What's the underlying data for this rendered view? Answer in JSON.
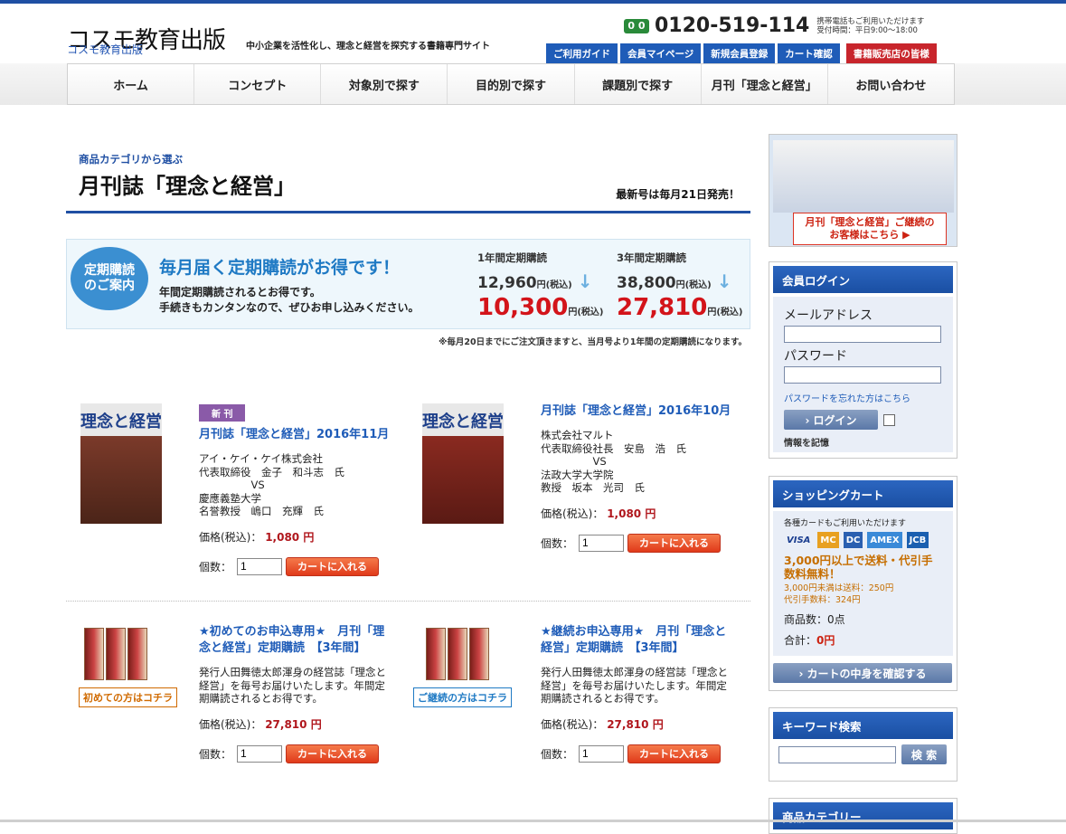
{
  "header": {
    "logo": "コスモ教育出版",
    "logo_alt": "コスモ教育出版",
    "tagline": "中小企業を活性化し、理念と経営を探究する書籍専門サイト",
    "phone_icon": "0 0",
    "phone": "0120-519-114",
    "phone_note_1": "携帯電話もご利用いただけます",
    "phone_note_2": "受付時間：平日9:00～18:00",
    "util_links": [
      "ご利用ガイド",
      "会員マイページ",
      "新規会員登録",
      "カート確認",
      "書籍販売店の皆様"
    ]
  },
  "nav": [
    "ホーム",
    "コンセプト",
    "対象別で探す",
    "目的別で探す",
    "課題別で探す",
    "月刊「理念と経営」",
    "お問い合わせ"
  ],
  "category": {
    "sub": "商品カテゴリから選ぶ",
    "title": "月刊誌「理念と経営」",
    "note": "最新号は毎月21日発売！"
  },
  "promo": {
    "badge_1": "定期購読",
    "badge_2": "のご案内",
    "headline": "毎月届く定期購読がお得です！",
    "desc_1": "年間定期購読されるとお得です。",
    "desc_2": "手続きもカンタンなので、ぜひお申し込みください。",
    "plan1_label": "1年間定期購読",
    "plan1_old": "12,960",
    "plan1_new": "10,300",
    "plan2_label": "3年間定期購読",
    "plan2_old": "38,800",
    "plan2_new": "27,810",
    "yen_tax": "円(税込)",
    "footnote": "※毎月20日までにご注文頂きますと、当月号より1年間の定期購読になります。"
  },
  "thumbs": {
    "magazine_title": "理念と経営",
    "label_first": "初めての方はコチラ",
    "label_continue": "ご継続の方はコチラ"
  },
  "products": [
    {
      "badge": "新 刊",
      "title": "月刊誌「理念と経営」2016年11月",
      "desc": "アイ・ケイ・ケイ株式会社\n代表取締役　金子　和斗志　氏\n　　　　　VS\n慶應義塾大学\n名誉教授　嶋口　充輝　氏",
      "price_label": "価格(税込)：",
      "price": "1,080 円",
      "qty_label": "個数：",
      "qty": "1",
      "cart": "カートに入れる"
    },
    {
      "title": "月刊誌「理念と経営」2016年10月",
      "desc": "株式会社マルト\n代表取締役社長　安島　浩　氏\n　　　　　VS\n法政大学大学院\n教授　坂本　光司　氏",
      "price_label": "価格(税込)：",
      "price": "1,080 円",
      "qty_label": "個数：",
      "qty": "1",
      "cart": "カートに入れる"
    },
    {
      "title": "★初めてのお申込専用★　月刊「理念と経営」定期購読　【3年間】",
      "desc": "発行人田舞徳太郎渾身の経営誌「理念と経営」を毎号お届けいたします。年間定期購読されるとお得です。",
      "price_label": "価格(税込)：",
      "price": "27,810 円",
      "qty_label": "個数：",
      "qty": "1",
      "cart": "カートに入れる"
    },
    {
      "title": "★継続お申込専用★　月刊「理念と経営」定期購読　【3年間】",
      "desc": "発行人田舞徳太郎渾身の経営誌「理念と経営」を毎号お届けいたします。年間定期購読されるとお得です。",
      "price_label": "価格(税込)：",
      "price": "27,810 円",
      "qty_label": "個数：",
      "qty": "1",
      "cart": "カートに入れる"
    }
  ],
  "sidebar": {
    "banner_1": "月刊「理念と経営」ご継続の",
    "banner_2": "お客様はこちら ▶",
    "login": {
      "title": "会員ログイン",
      "email_label": "メールアドレス",
      "password_label": "パスワード",
      "forgot": "パスワードを忘れた方はこちら",
      "button": "› ログイン",
      "remember": "情報を記憶"
    },
    "cart": {
      "title": "ショッピングカート",
      "cards_note": "各種カードもご利用いただけます",
      "cards": [
        "VISA",
        "MC",
        "DC",
        "AMEX",
        "JCB"
      ],
      "ship_free": "3,000円以上で送料・代引手数料無料！",
      "ship_note_1": "3,000円未満は送料：250円",
      "ship_note_2": "代引手数料：324円",
      "count_label": "商品数：",
      "count": "0点",
      "total_label": "合計：",
      "total": "0円",
      "button": "› カートの中身を確認する"
    },
    "keyword": {
      "title": "キーワード検索",
      "button": "検 索"
    },
    "category_title": "商品カテゴリー"
  }
}
